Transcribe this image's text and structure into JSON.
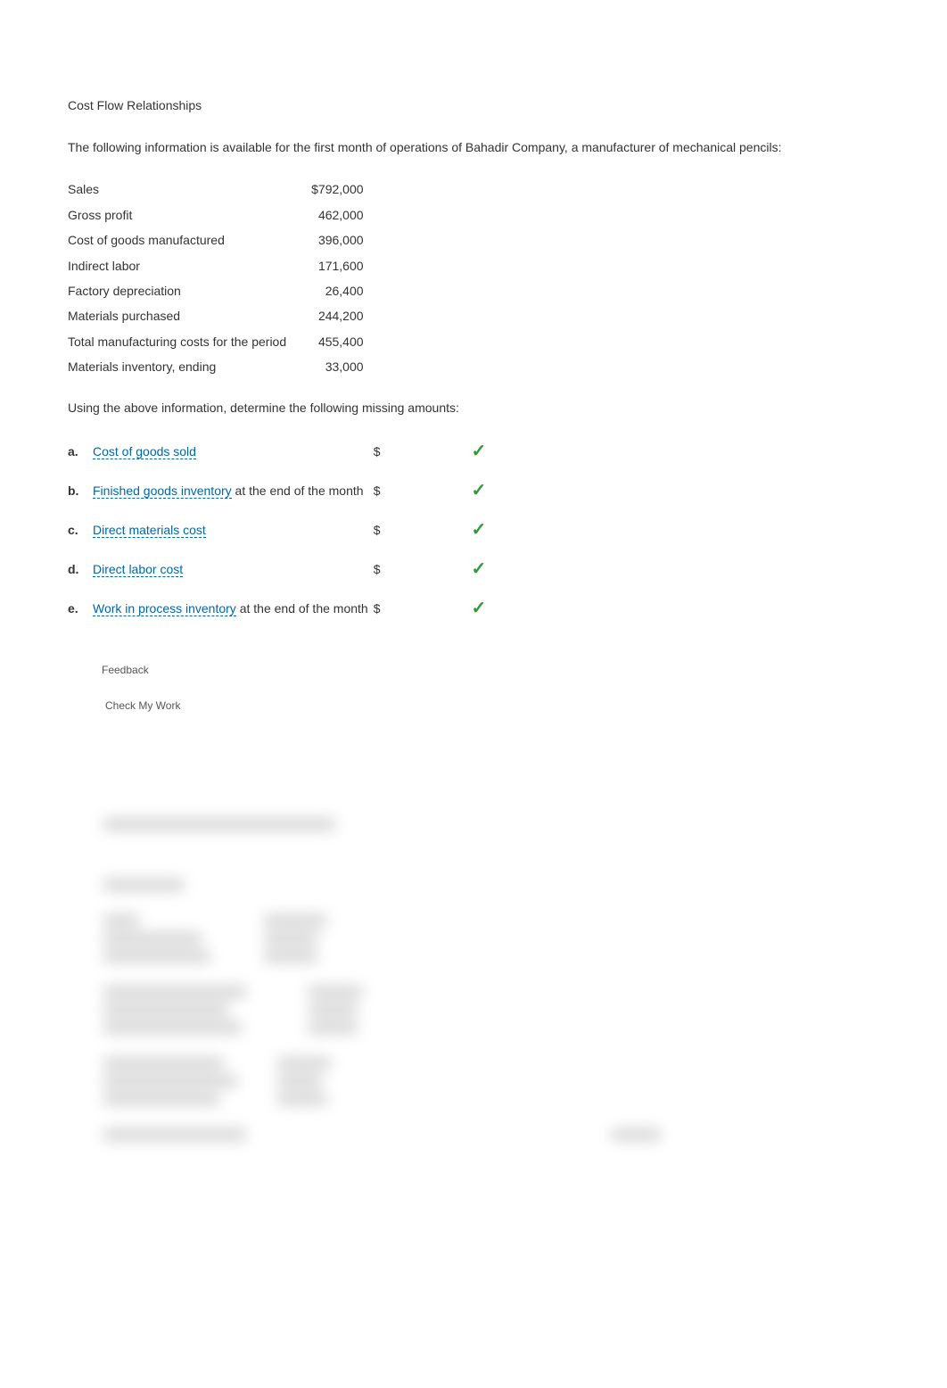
{
  "title": "Cost Flow Relationships",
  "intro": "The following information is available for the first month of operations of Bahadir Company, a manufacturer of mechanical pencils:",
  "given": [
    {
      "label": "Sales",
      "value": "$792,000"
    },
    {
      "label": "Gross profit",
      "value": "462,000"
    },
    {
      "label": "Cost of goods manufactured",
      "value": "396,000"
    },
    {
      "label": "Indirect labor",
      "value": "171,600"
    },
    {
      "label": "Factory depreciation",
      "value": "26,400"
    },
    {
      "label": "Materials purchased",
      "value": "244,200"
    },
    {
      "label": "Total manufacturing costs for the period",
      "value": "455,400"
    },
    {
      "label": "Materials inventory, ending",
      "value": "33,000"
    }
  ],
  "instruction": "Using the above information, determine the following missing amounts:",
  "questions": [
    {
      "letter": "a.",
      "pre": "",
      "link": "Cost of goods sold",
      "post": ""
    },
    {
      "letter": "b.",
      "pre": "",
      "link": "Finished goods inventory",
      "post": " at the end of the month"
    },
    {
      "letter": "c.",
      "pre": "",
      "link": "Direct materials cost",
      "post": ""
    },
    {
      "letter": "d.",
      "pre": "",
      "link": "Direct labor cost",
      "post": ""
    },
    {
      "letter": "e.",
      "pre": "",
      "link": "Work in process inventory",
      "post": " at the end of the month"
    }
  ],
  "dollar": "$",
  "checkmark": "✓",
  "feedback_label": "Feedback",
  "check_my_work_label": "Check My Work"
}
